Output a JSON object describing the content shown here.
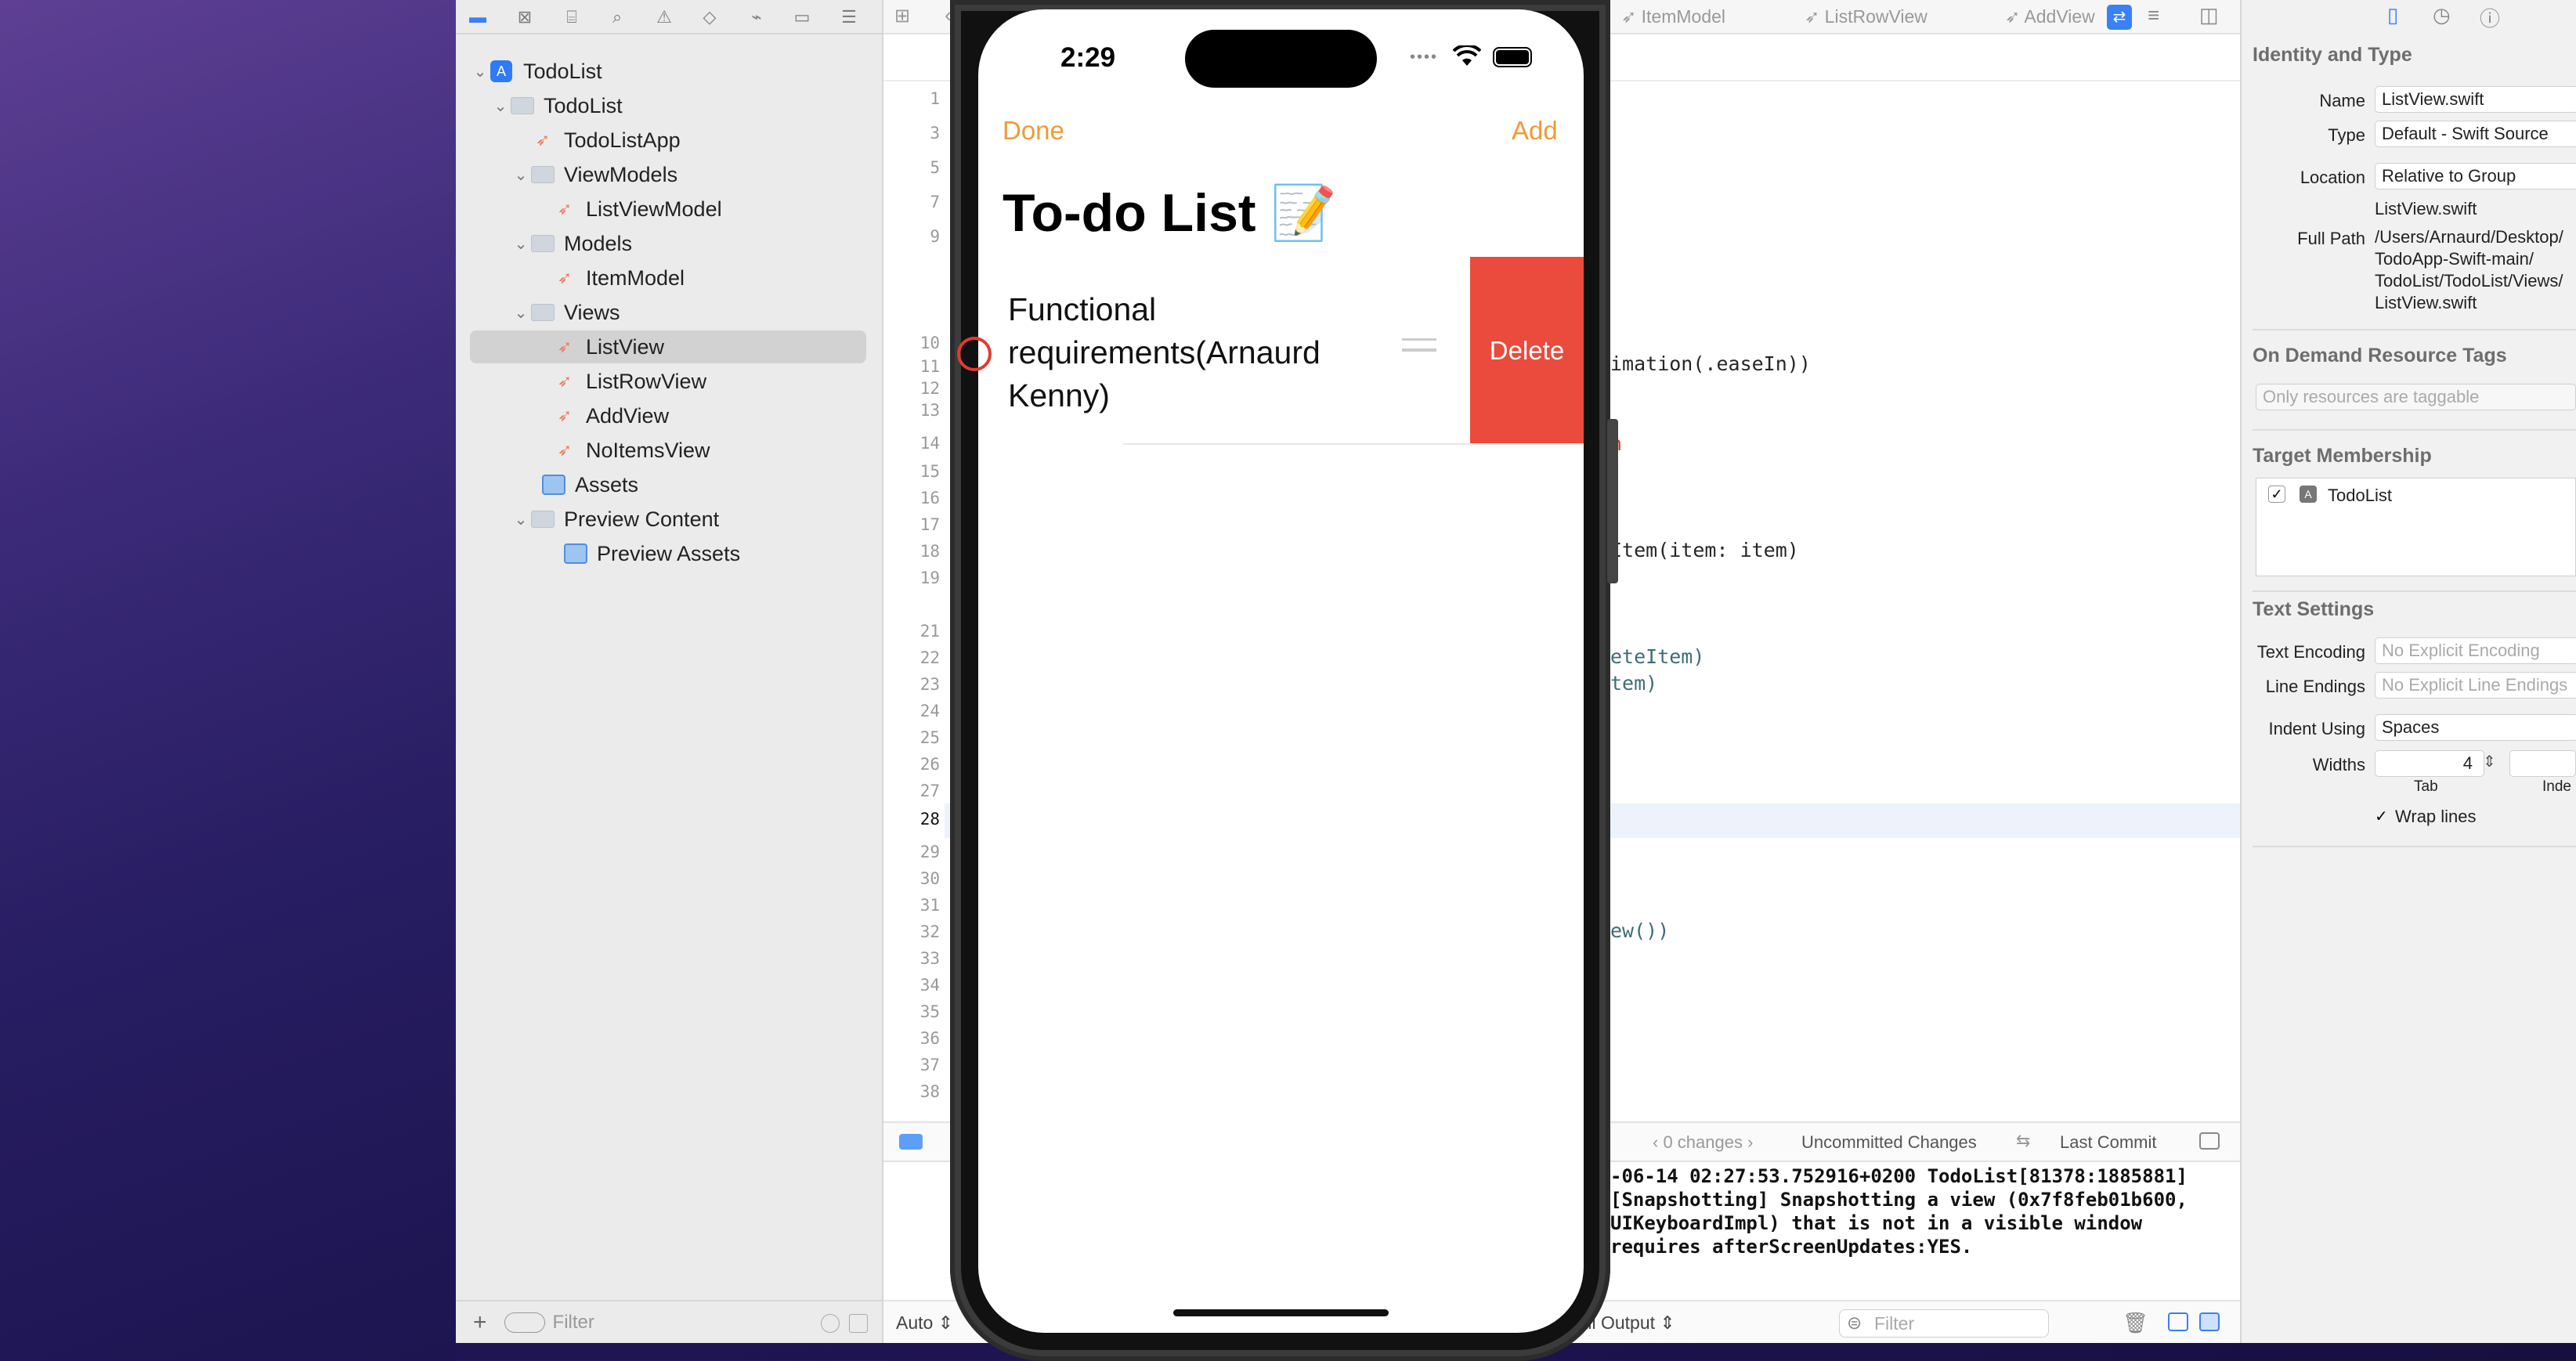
{
  "navigator": {
    "items": [
      {
        "label": "TodoList",
        "kind": "project"
      },
      {
        "label": "TodoList",
        "kind": "group"
      },
      {
        "label": "TodoListApp",
        "kind": "swift"
      },
      {
        "label": "ViewModels",
        "kind": "group"
      },
      {
        "label": "ListViewModel",
        "kind": "swift"
      },
      {
        "label": "Models",
        "kind": "group"
      },
      {
        "label": "ItemModel",
        "kind": "swift"
      },
      {
        "label": "Views",
        "kind": "group"
      },
      {
        "label": "ListView",
        "kind": "swift",
        "selected": true
      },
      {
        "label": "ListRowView",
        "kind": "swift"
      },
      {
        "label": "AddView",
        "kind": "swift"
      },
      {
        "label": "NoItemsView",
        "kind": "swift"
      },
      {
        "label": "Assets",
        "kind": "asset"
      },
      {
        "label": "Preview Content",
        "kind": "group"
      },
      {
        "label": "Preview Assets",
        "kind": "asset"
      }
    ],
    "filter_placeholder": "Filter"
  },
  "editor": {
    "tabs": [
      "ItemModel",
      "ListRowView",
      "AddView"
    ],
    "current_line": "28",
    "code_fragments": [
      "imation(.easeIn))",
      "n",
      "Item(item: item)",
      "eteItem)",
      "tem)",
      "ew())"
    ]
  },
  "debug": {
    "changes": "0 changes",
    "uncommitted": "Uncommitted Changes",
    "last_commit": "Last Commit",
    "console_lines": [
      "-06-14 02:27:53.752916+0200 TodoList[81378:1885881]",
      "[Snapshotting] Snapshotting a view (0x7f8feb01b600,",
      "UIKeyboardImpl) that is not in a visible window",
      "requires afterScreenUpdates:YES."
    ],
    "auto_label": "Auto",
    "output_label": "All Output",
    "filter_placeholder": "Filter"
  },
  "inspector": {
    "identity_title": "Identity and Type",
    "name_label": "Name",
    "name_value": "ListView.swift",
    "type_label": "Type",
    "type_value": "Default - Swift Source",
    "location_label": "Location",
    "location_value": "Relative to Group",
    "location_file": "ListView.swift",
    "fullpath_label": "Full Path",
    "fullpath_lines": [
      "/Users/Arnaurd/Desktop/",
      "TodoApp-Swift-main/",
      "TodoList/TodoList/Views/",
      "ListView.swift"
    ],
    "odr_title": "On Demand Resource Tags",
    "odr_placeholder": "Only resources are taggable",
    "target_title": "Target Membership",
    "target_name": "TodoList",
    "text_title": "Text Settings",
    "encoding_label": "Text Encoding",
    "encoding_value": "No Explicit Encoding",
    "endings_label": "Line Endings",
    "endings_value": "No Explicit Line Endings",
    "indent_label": "Indent Using",
    "indent_value": "Spaces",
    "widths_label": "Widths",
    "tab_width": "4",
    "tab_label": "Tab",
    "indent_sub": "Inde",
    "wrap_label": "Wrap lines"
  },
  "phone": {
    "time": "2:29",
    "done": "Done",
    "add": "Add",
    "title": "To-do List 📝",
    "row_text_lines": [
      "Functional",
      "requirements(Arnaurd",
      "Kenny)"
    ],
    "delete": "Delete",
    "accent": "#f09a37",
    "delete_color": "#ea4b3c"
  }
}
